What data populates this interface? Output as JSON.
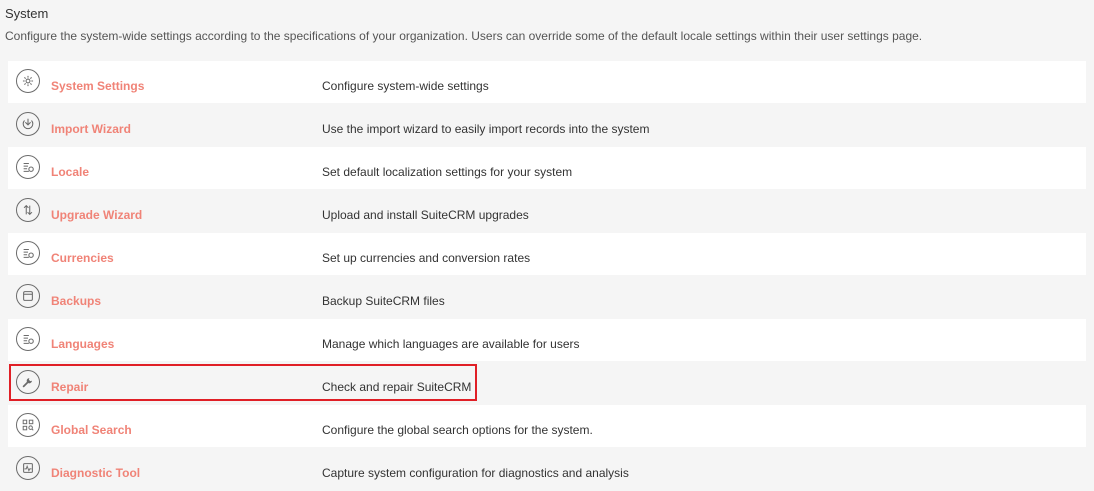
{
  "section": {
    "title": "System",
    "description": "Configure the system-wide settings according to the specifications of your organization. Users can override some of the default locale settings within their user settings page."
  },
  "items": [
    {
      "icon": "gear-icon",
      "label": "System Settings",
      "description": "Configure system-wide settings"
    },
    {
      "icon": "import-icon",
      "label": "Import Wizard",
      "description": "Use the import wizard to easily import records into the system"
    },
    {
      "icon": "locale-icon",
      "label": "Locale",
      "description": "Set default localization settings for your system"
    },
    {
      "icon": "upgrade-icon",
      "label": "Upgrade Wizard",
      "description": "Upload and install SuiteCRM upgrades"
    },
    {
      "icon": "currency-icon",
      "label": "Currencies",
      "description": "Set up currencies and conversion rates"
    },
    {
      "icon": "backup-icon",
      "label": "Backups",
      "description": "Backup SuiteCRM files"
    },
    {
      "icon": "language-icon",
      "label": "Languages",
      "description": "Manage which languages are available for users"
    },
    {
      "icon": "wrench-icon",
      "label": "Repair",
      "description": "Check and repair SuiteCRM"
    },
    {
      "icon": "global-search-icon",
      "label": "Global Search",
      "description": "Configure the global search options for the system."
    },
    {
      "icon": "diagnostic-icon",
      "label": "Diagnostic Tool",
      "description": "Capture system configuration for diagnostics and analysis"
    }
  ],
  "highlight": {
    "item": "Repair",
    "color": "#e01f26"
  },
  "colors": {
    "link": "#f08377",
    "text": "#333333",
    "row_bg": "#ffffff",
    "row_alt_bg": "#f5f5f5"
  }
}
